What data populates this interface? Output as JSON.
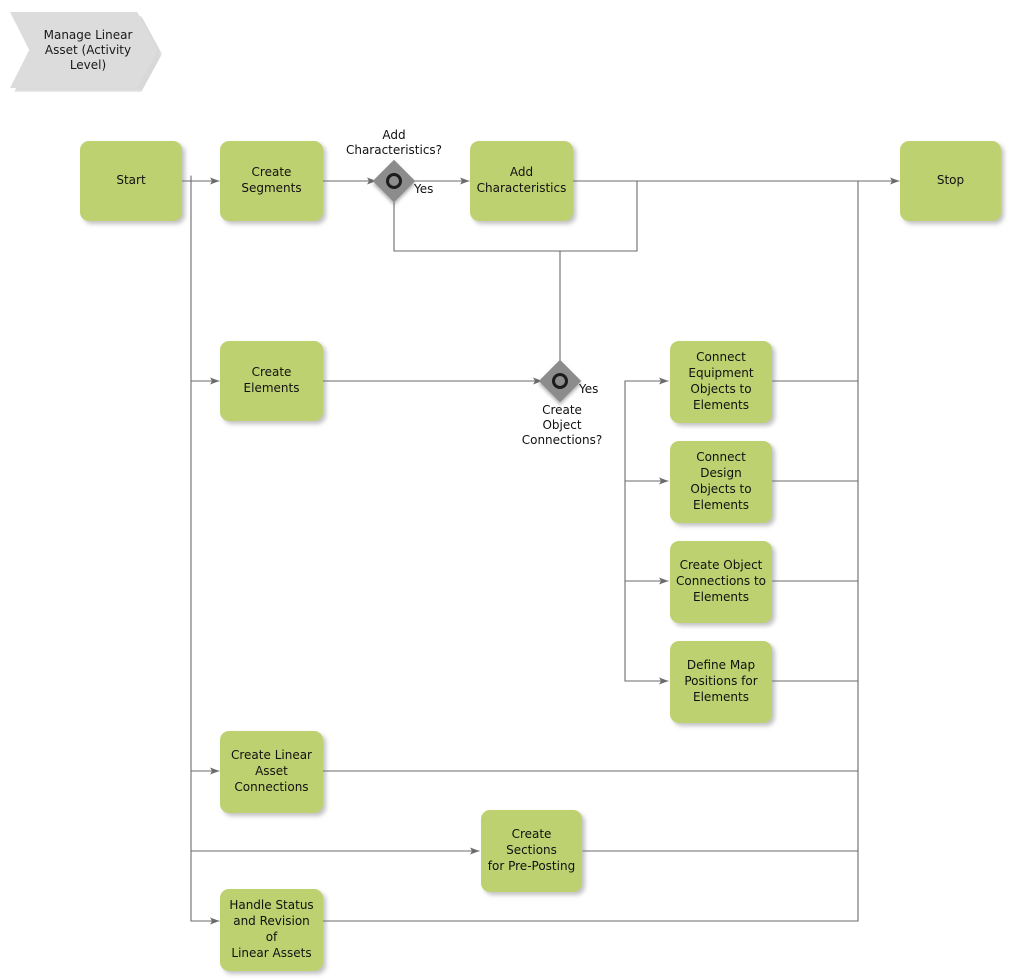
{
  "diagram": {
    "title": "Manage Linear Asset (Activity Level)",
    "type": "flowchart",
    "colors": {
      "activity_fill": "#bed170",
      "banner_fill": "#dcdcdc",
      "gateway_fill": "#8c8c8c",
      "gateway_ring": "#1c1c1c",
      "edge": "#6b6b6b",
      "text": "#111111",
      "background": "#ffffff"
    }
  },
  "banner": {
    "label": "Manage Linear\nAsset (Activity\nLevel)"
  },
  "nodes": {
    "start": {
      "label": "Start"
    },
    "create_segments": {
      "label": "Create\nSegments"
    },
    "add_characteristics": {
      "label": "Add\nCharacteristics"
    },
    "stop": {
      "label": "Stop"
    },
    "create_elements": {
      "label": "Create\nElements"
    },
    "connect_equipment": {
      "label": "Connect\nEquipment\nObjects to\nElements"
    },
    "connect_design": {
      "label": "Connect Design\nObjects to\nElements"
    },
    "create_object_connections": {
      "label": "Create Object\nConnections to\nElements"
    },
    "define_map_positions": {
      "label": "Define Map\nPositions for\nElements"
    },
    "create_linear_asset_connections": {
      "label": "Create Linear\nAsset\nConnections"
    },
    "create_sections": {
      "label": "Create Sections\nfor Pre-Posting"
    },
    "handle_status": {
      "label": "Handle Status\nand Revision of\nLinear Assets"
    }
  },
  "gateways": {
    "add_characteristics_decision": {
      "question": "Add\nCharacteristics?",
      "yes_label": "Yes"
    },
    "create_object_connections_decision": {
      "question": "Create\nObject\nConnections?",
      "yes_label": "Yes"
    }
  }
}
